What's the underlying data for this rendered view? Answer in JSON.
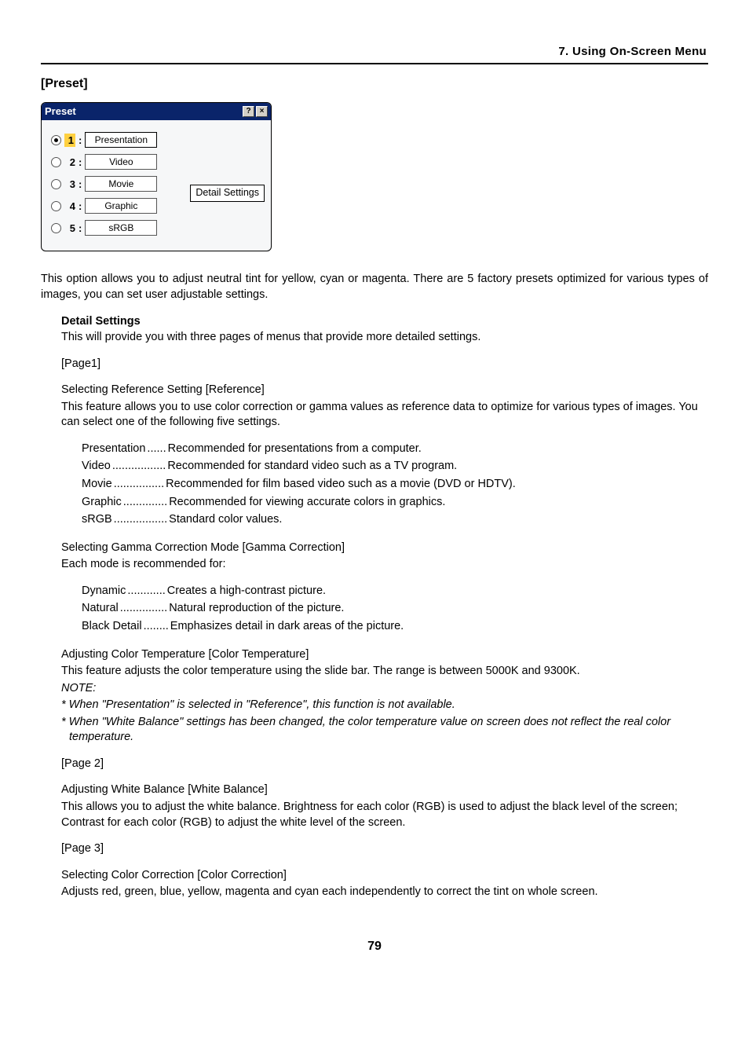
{
  "header": {
    "chapter": "7. Using On-Screen Menu"
  },
  "section": {
    "title": "[Preset]"
  },
  "dialog": {
    "title": "Preset",
    "help_glyph": "?",
    "close_glyph": "×",
    "detail_button": "Detail Settings",
    "rows": [
      {
        "num": "1",
        "value": "Presentation",
        "selected": true
      },
      {
        "num": "2",
        "value": "Video",
        "selected": false
      },
      {
        "num": "3",
        "value": "Movie",
        "selected": false
      },
      {
        "num": "4",
        "value": "Graphic",
        "selected": false
      },
      {
        "num": "5",
        "value": "sRGB",
        "selected": false
      }
    ]
  },
  "intro": "This option allows you to adjust neutral tint for yellow, cyan or magenta. There are 5 factory presets optimized for various types of images, you can set user adjustable settings.",
  "detail_settings": {
    "heading": "Detail Settings",
    "desc": "This will provide you with three pages of menus that provide more detailed settings."
  },
  "page1": {
    "label": "[Page1]",
    "ref_heading": "Selecting Reference Setting [Reference]",
    "ref_desc": "This feature allows you to use color correction or gamma values as reference data to optimize for various types of images. You can select one of the following five settings.",
    "ref_items": [
      {
        "term": "Presentation",
        "dots": " ...... ",
        "desc": "Recommended for presentations from a computer."
      },
      {
        "term": "Video",
        "dots": " ................. ",
        "desc": "Recommended for standard video such as a TV program."
      },
      {
        "term": "Movie",
        "dots": " ................ ",
        "desc": "Recommended for film based video such as a movie (DVD or HDTV)."
      },
      {
        "term": "Graphic",
        "dots": " .............. ",
        "desc": "Recommended for viewing accurate colors in graphics."
      },
      {
        "term": "sRGB",
        "dots": " ................. ",
        "desc": "Standard color values."
      }
    ],
    "gamma_heading": "Selecting Gamma Correction Mode [Gamma Correction]",
    "gamma_desc": "Each mode is recommended for:",
    "gamma_items": [
      {
        "term": "Dynamic",
        "dots": " ............ ",
        "desc": "Creates a high-contrast picture."
      },
      {
        "term": "Natural",
        "dots": " ............... ",
        "desc": "Natural reproduction of the picture."
      },
      {
        "term": "Black Detail",
        "dots": " ........ ",
        "desc": "Emphasizes detail in dark areas of the picture."
      }
    ],
    "ct_heading": "Adjusting Color Temperature [Color Temperature]",
    "ct_desc": "This feature adjusts the color temperature using the slide bar. The range is between 5000K and 9300K.",
    "note_label": "NOTE:",
    "note1": "*  When \"Presentation\" is selected in \"Reference\", this function is not available.",
    "note2": "*  When \"White Balance\" settings has been changed, the color temperature value on screen does not reflect the real color temperature."
  },
  "page2": {
    "label": "[Page 2]",
    "wb_heading": "Adjusting White Balance [White Balance]",
    "wb_desc": "This allows you to adjust the white balance. Brightness for each color (RGB) is used to adjust the black level of the screen; Contrast for each color (RGB) to adjust the white level of the screen."
  },
  "page3": {
    "label": "[Page 3]",
    "cc_heading": "Selecting Color Correction [Color Correction]",
    "cc_desc": "Adjusts red, green, blue, yellow, magenta and cyan each independently to correct the tint on whole screen."
  },
  "pagenum": "79"
}
